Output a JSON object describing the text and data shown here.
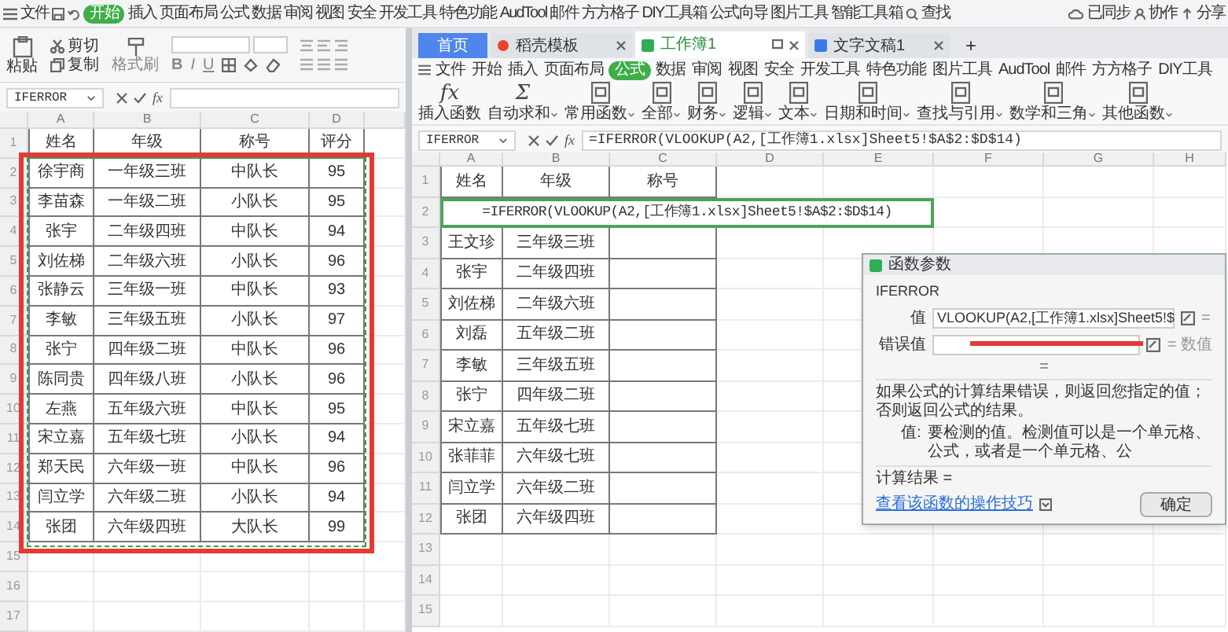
{
  "top_menu": {
    "items": [
      {
        "label": "文件",
        "selected": false
      },
      {
        "label": "开始",
        "selected": true
      },
      {
        "label": "插入",
        "selected": false
      },
      {
        "label": "页面布局",
        "selected": false
      },
      {
        "label": "公式",
        "selected": false
      },
      {
        "label": "数据",
        "selected": false
      },
      {
        "label": "审阅",
        "selected": false
      },
      {
        "label": "视图",
        "selected": false
      },
      {
        "label": "安全",
        "selected": false
      },
      {
        "label": "开发工具",
        "selected": false
      },
      {
        "label": "特色功能",
        "selected": false
      },
      {
        "label": "AudTool",
        "selected": false
      },
      {
        "label": "邮件",
        "selected": false
      },
      {
        "label": "方方格子",
        "selected": false
      },
      {
        "label": "DIY工具箱",
        "selected": false
      },
      {
        "label": "公式向导",
        "selected": false
      },
      {
        "label": "图片工具",
        "selected": false
      },
      {
        "label": "智能工具箱",
        "selected": false
      }
    ],
    "search": "查找",
    "sync": "已同步",
    "collab": "协作",
    "share": "分享"
  },
  "left_window": {
    "ribbon": {
      "paste": "粘贴",
      "cut": "剪切",
      "copy": "复制",
      "format_painter": "格式刷",
      "bold": "B",
      "italic": "I",
      "underline": "U"
    },
    "formula_bar": {
      "name_box": "IFERROR",
      "fx": "fx"
    },
    "sheet": {
      "columns": [
        "A",
        "B",
        "C",
        "D",
        ""
      ],
      "rows": [
        {
          "number": "1",
          "cells": [
            "姓名",
            "年级",
            "称号",
            "评分"
          ]
        },
        {
          "number": "2",
          "cells": [
            "徐宇商",
            "一年级三班",
            "中队长",
            "95"
          ]
        },
        {
          "number": "3",
          "cells": [
            "李苗森",
            "一年级二班",
            "小队长",
            "95"
          ]
        },
        {
          "number": "4",
          "cells": [
            "张宇",
            "二年级四班",
            "中队长",
            "94"
          ]
        },
        {
          "number": "5",
          "cells": [
            "刘佐梯",
            "二年级六班",
            "小队长",
            "96"
          ]
        },
        {
          "number": "6",
          "cells": [
            "张静云",
            "三年级一班",
            "中队长",
            "93"
          ]
        },
        {
          "number": "7",
          "cells": [
            "李敏",
            "三年级五班",
            "小队长",
            "97"
          ]
        },
        {
          "number": "8",
          "cells": [
            "张宁",
            "四年级二班",
            "中队长",
            "96"
          ]
        },
        {
          "number": "9",
          "cells": [
            "陈同贵",
            "四年级八班",
            "小队长",
            "96"
          ]
        },
        {
          "number": "10",
          "cells": [
            "左燕",
            "五年级六班",
            "中队长",
            "95"
          ]
        },
        {
          "number": "11",
          "cells": [
            "宋立嘉",
            "五年级七班",
            "小队长",
            "94"
          ]
        },
        {
          "number": "12",
          "cells": [
            "郑天民",
            "六年级一班",
            "中队长",
            "96"
          ]
        },
        {
          "number": "13",
          "cells": [
            "闫立学",
            "六年级二班",
            "小队长",
            "94"
          ]
        },
        {
          "number": "14",
          "cells": [
            "张团",
            "六年级四班",
            "大队长",
            "99"
          ]
        },
        {
          "number": "15",
          "cells": []
        },
        {
          "number": "16",
          "cells": []
        },
        {
          "number": "17",
          "cells": []
        }
      ]
    }
  },
  "right_window": {
    "tabs": [
      {
        "label": "首页",
        "kind": "home",
        "selected": false
      },
      {
        "label": "稻壳模板",
        "kind": "template",
        "selected": false
      },
      {
        "label": "工作簿1",
        "kind": "sheet",
        "selected": true
      },
      {
        "label": "文字文稿1",
        "kind": "writer",
        "selected": false
      }
    ],
    "new_tab": "+",
    "menu": [
      {
        "label": "文件",
        "selected": false
      },
      {
        "label": "开始",
        "selected": false
      },
      {
        "label": "插入",
        "selected": false
      },
      {
        "label": "页面布局",
        "selected": false
      },
      {
        "label": "公式",
        "selected": true
      },
      {
        "label": "数据",
        "selected": false
      },
      {
        "label": "审阅",
        "selected": false
      },
      {
        "label": "视图",
        "selected": false
      },
      {
        "label": "安全",
        "selected": false
      },
      {
        "label": "开发工具",
        "selected": false
      },
      {
        "label": "特色功能",
        "selected": false
      },
      {
        "label": "图片工具",
        "selected": false
      },
      {
        "label": "AudTool",
        "selected": false
      },
      {
        "label": "邮件",
        "selected": false
      },
      {
        "label": "方方格子",
        "selected": false
      },
      {
        "label": "DIY工具",
        "selected": false
      }
    ],
    "ribbon": [
      {
        "glyph": "fx",
        "label": "插入函数",
        "dropdown": false
      },
      {
        "glyph": "Σ",
        "label": "自动求和",
        "dropdown": true
      },
      {
        "label": "常用函数",
        "dropdown": true
      },
      {
        "label": "全部",
        "dropdown": true
      },
      {
        "label": "财务",
        "dropdown": true
      },
      {
        "label": "逻辑",
        "dropdown": true
      },
      {
        "label": "文本",
        "dropdown": true
      },
      {
        "label": "日期和时间",
        "dropdown": true
      },
      {
        "label": "查找与引用",
        "dropdown": true
      },
      {
        "label": "数学和三角",
        "dropdown": true
      },
      {
        "label": "其他函数",
        "dropdown": true
      }
    ],
    "formula_bar": {
      "name_box": "IFERROR",
      "fx": "fx",
      "formula": "=IFERROR(VLOOKUP(A2,[工作簿1.xlsx]Sheet5!$A$2:$D$14)"
    },
    "sheet": {
      "columns": [
        "A",
        "B",
        "C",
        "D",
        "E",
        "F",
        "G",
        "H"
      ],
      "rows": [
        {
          "number": "1",
          "kind": "cells",
          "cells": [
            "姓名",
            "年级",
            "称号"
          ]
        },
        {
          "number": "2",
          "kind": "formula",
          "text": "=IFERROR(VLOOKUP(A2,[工作簿1.xlsx]Sheet5!$A$2:$D$14)"
        },
        {
          "number": "3",
          "kind": "cells",
          "cells": [
            "王文珍",
            "三年级三班"
          ]
        },
        {
          "number": "4",
          "kind": "cells",
          "cells": [
            "张宇",
            "二年级四班"
          ]
        },
        {
          "number": "5",
          "kind": "cells",
          "cells": [
            "刘佐梯",
            "二年级六班"
          ]
        },
        {
          "number": "6",
          "kind": "cells",
          "cells": [
            "刘磊",
            "五年级二班"
          ]
        },
        {
          "number": "7",
          "kind": "cells",
          "cells": [
            "李敏",
            "三年级五班"
          ]
        },
        {
          "number": "8",
          "kind": "cells",
          "cells": [
            "张宁",
            "四年级二班"
          ]
        },
        {
          "number": "9",
          "kind": "cells",
          "cells": [
            "宋立嘉",
            "五年级七班"
          ]
        },
        {
          "number": "10",
          "kind": "cells",
          "cells": [
            "张菲菲",
            "六年级七班"
          ]
        },
        {
          "number": "11",
          "kind": "cells",
          "cells": [
            "闫立学",
            "六年级二班"
          ]
        },
        {
          "number": "12",
          "kind": "cells",
          "cells": [
            "张团",
            "六年级四班"
          ]
        },
        {
          "number": "13",
          "kind": "cells",
          "cells": []
        },
        {
          "number": "14",
          "kind": "cells",
          "cells": []
        },
        {
          "number": "15",
          "kind": "cells",
          "cells": []
        }
      ]
    },
    "dialog": {
      "title": "函数参数",
      "function": "IFERROR",
      "args": [
        {
          "label": "值",
          "value": "VLOOKUP(A2,[工作簿1.xlsx]Sheet5!$",
          "result": "="
        },
        {
          "label": "错误值",
          "result": "= 数值"
        }
      ],
      "separator": "=",
      "description": "如果公式的计算结果错误，则返回您指定的值；否则返回公式的结果。",
      "arg_help_label": "值:",
      "arg_help": "要检测的值。检测值可以是一个单元格、公式，或者是一个单元格、公",
      "result_label": "计算结果 =",
      "help_link": "查看该函数的操作技巧",
      "ok_button": "确定"
    }
  }
}
